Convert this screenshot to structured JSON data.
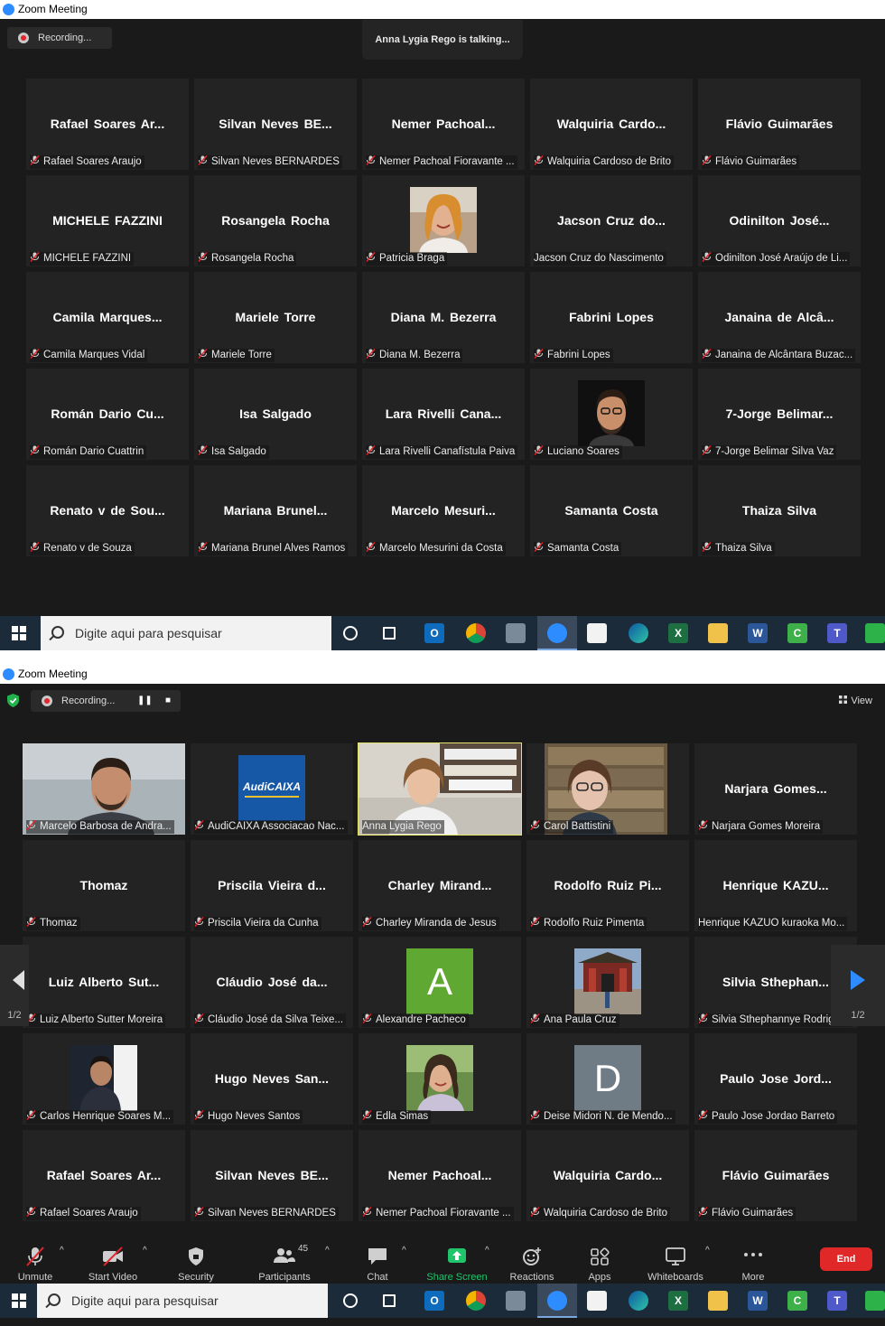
{
  "window_title": "Zoom Meeting",
  "recording_label": "Recording...",
  "shot1": {
    "talking_banner": "Anna Lygia Rego is talking...",
    "tiles": [
      {
        "big": "Rafael Soares Ar...",
        "name": "Rafael Soares Araujo",
        "muted": true
      },
      {
        "big": "Silvan Neves BE...",
        "name": "Silvan Neves BERNARDES",
        "muted": true
      },
      {
        "big": "Nemer Pachoal...",
        "name": "Nemer Pachoal Fioravante ...",
        "muted": true
      },
      {
        "big": "Walquiria Cardo...",
        "name": "Walquiria Cardoso de Brito",
        "muted": true
      },
      {
        "big": "Flávio Guimarães",
        "name": "Flávio Guimarães",
        "muted": true
      },
      {
        "big": "MICHELE FAZZINI",
        "name": "MICHELE FAZZINI",
        "muted": true
      },
      {
        "big": "Rosangela Rocha",
        "name": "Rosangela Rocha",
        "muted": true
      },
      {
        "big": "",
        "name": "Patricia Braga",
        "muted": true,
        "photo": "woman-smiling"
      },
      {
        "big": "Jacson Cruz do...",
        "name": "Jacson Cruz do Nascimento",
        "muted": false
      },
      {
        "big": "Odinilton José...",
        "name": "Odinilton José Araújo de Li...",
        "muted": true
      },
      {
        "big": "Camila Marques...",
        "name": "Camila Marques Vidal",
        "muted": true
      },
      {
        "big": "Mariele Torre",
        "name": "Mariele Torre",
        "muted": true
      },
      {
        "big": "Diana M. Bezerra",
        "name": "Diana M. Bezerra",
        "muted": true
      },
      {
        "big": "Fabrini Lopes",
        "name": "Fabrini Lopes",
        "muted": true
      },
      {
        "big": "Janaina de Alcâ...",
        "name": "Janaina de Alcântara Buzac...",
        "muted": true
      },
      {
        "big": "Román Dario Cu...",
        "name": "Román Dario Cuattrin",
        "muted": true
      },
      {
        "big": "Isa Salgado",
        "name": "Isa Salgado",
        "muted": true
      },
      {
        "big": "Lara Rivelli Cana...",
        "name": "Lara Rivelli Canafístula Paiva",
        "muted": true
      },
      {
        "big": "",
        "name": "Luciano Soares",
        "muted": true,
        "photo": "man-portrait"
      },
      {
        "big": "7-Jorge Belimar...",
        "name": "7-Jorge Belimar Silva Vaz",
        "muted": true
      },
      {
        "big": "Renato v de Sou...",
        "name": "Renato v de Souza",
        "muted": true
      },
      {
        "big": "Mariana Brunel...",
        "name": "Mariana Brunel Alves Ramos",
        "muted": true
      },
      {
        "big": "Marcelo Mesuri...",
        "name": "Marcelo Mesurini da Costa",
        "muted": true
      },
      {
        "big": "Samanta Costa",
        "name": "Samanta Costa",
        "muted": true
      },
      {
        "big": "Thaiza Silva",
        "name": "Thaiza Silva",
        "muted": true
      }
    ]
  },
  "shot2": {
    "view_label": "View",
    "page_indicator": "1/2",
    "tiles": [
      {
        "big": "",
        "name": "Marcelo Barbosa de Andra...",
        "muted": true,
        "photo": "video-man"
      },
      {
        "big": "",
        "name": "AudiCAIXA Associacao Nac...",
        "muted": true,
        "photo": "audicaixa-logo",
        "logo_text": "AudiCAIXA"
      },
      {
        "big": "",
        "name": "Anna Lygia Rego",
        "muted": false,
        "photo": "video-woman",
        "active": true
      },
      {
        "big": "",
        "name": "Carol Battistini",
        "muted": true,
        "photo": "video-bookshelf"
      },
      {
        "big": "Narjara Gomes...",
        "name": "Narjara Gomes Moreira",
        "muted": true
      },
      {
        "big": "Thomaz",
        "name": "Thomaz",
        "muted": true
      },
      {
        "big": "Priscila Vieira d...",
        "name": "Priscila Vieira da Cunha",
        "muted": true
      },
      {
        "big": "Charley Mirand...",
        "name": "Charley Miranda de Jesus",
        "muted": true
      },
      {
        "big": "Rodolfo Ruiz Pi...",
        "name": "Rodolfo Ruiz Pimenta",
        "muted": true
      },
      {
        "big": "Henrique KAZU...",
        "name": "Henrique KAZUO kuraoka Mo...",
        "muted": false
      },
      {
        "big": "Luiz Alberto Sut...",
        "name": "Luiz Alberto Sutter Moreira",
        "muted": true
      },
      {
        "big": "Cláudio José da...",
        "name": "Cláudio José da Silva Teixe...",
        "muted": true
      },
      {
        "big": "",
        "name": "Alexandre Pacheco",
        "muted": true,
        "letter": "A",
        "letter_color": "#5fa832"
      },
      {
        "big": "",
        "name": "Ana Paula Cruz",
        "muted": true,
        "photo": "temple"
      },
      {
        "big": "Silvia Sthephan...",
        "name": "Silvia Sthephannye Rodrigu...",
        "muted": true
      },
      {
        "big": "",
        "name": "Carlos Henrique Soares M...",
        "muted": true,
        "photo": "man-dark"
      },
      {
        "big": "Hugo Neves San...",
        "name": "Hugo Neves Santos",
        "muted": true
      },
      {
        "big": "",
        "name": "Edla Simas",
        "muted": true,
        "photo": "woman-outdoor"
      },
      {
        "big": "",
        "name": "Deise Midori N. de Mendo...",
        "muted": true,
        "letter": "D",
        "letter_color": "#6f7b85"
      },
      {
        "big": "Paulo Jose Jord...",
        "name": "Paulo Jose Jordao Barreto",
        "muted": true
      },
      {
        "big": "Rafael Soares Ar...",
        "name": "Rafael Soares Araujo",
        "muted": true
      },
      {
        "big": "Silvan Neves BE...",
        "name": "Silvan Neves BERNARDES",
        "muted": true
      },
      {
        "big": "Nemer Pachoal...",
        "name": "Nemer Pachoal Fioravante ...",
        "muted": true
      },
      {
        "big": "Walquiria Cardo...",
        "name": "Walquiria Cardoso de Brito",
        "muted": true
      },
      {
        "big": "Flávio Guimarães",
        "name": "Flávio Guimarães",
        "muted": true
      }
    ],
    "toolbar": {
      "unmute": "Unmute",
      "start_video": "Start Video",
      "security": "Security",
      "participants": "Participants",
      "participant_count": "45",
      "chat": "Chat",
      "share_screen": "Share Screen",
      "reactions": "Reactions",
      "apps": "Apps",
      "whiteboards": "Whiteboards",
      "more": "More",
      "end": "End"
    }
  },
  "taskbar": {
    "search_placeholder": "Digite aqui para pesquisar"
  },
  "colors": {
    "zoom_blue": "#2d8cff",
    "end_red": "#e02828",
    "active_speaker": "#e6e36b",
    "share_green": "#1fc46b",
    "muted_red": "#e0252b"
  }
}
